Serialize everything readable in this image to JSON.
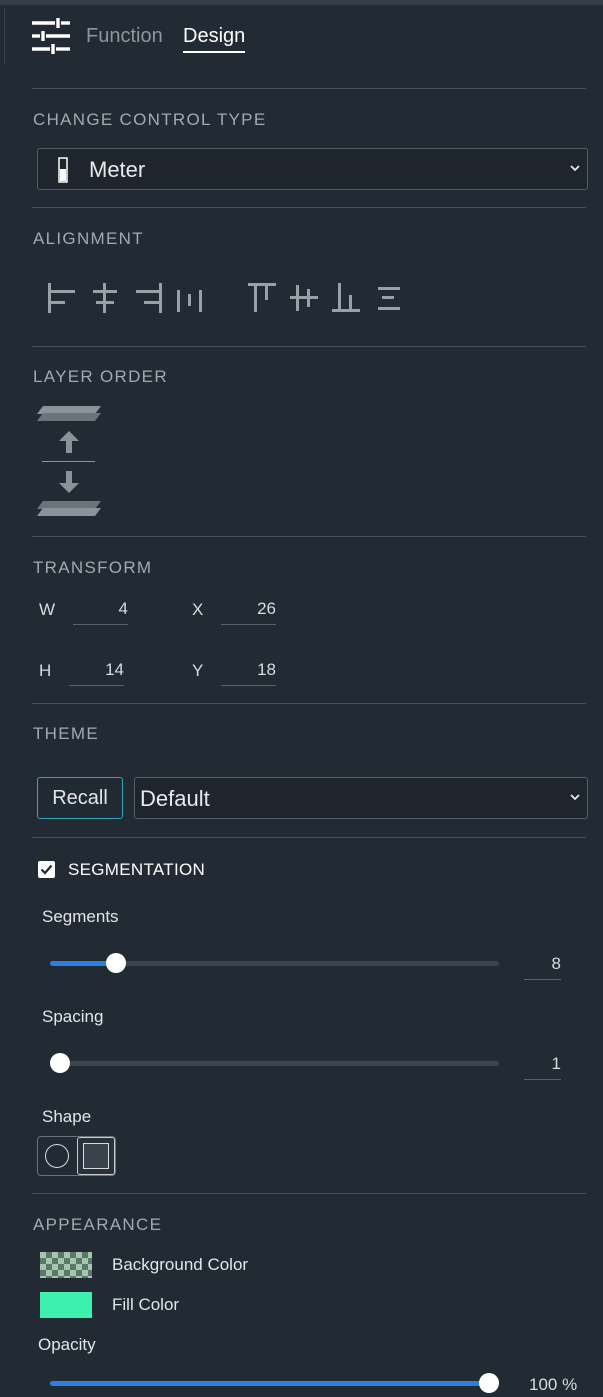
{
  "tabs": {
    "function_label": "Function",
    "design_label": "Design",
    "active": "Design"
  },
  "change_control_type": {
    "title": "CHANGE CONTROL TYPE",
    "selected": "Meter",
    "icon": "meter-icon"
  },
  "alignment": {
    "title": "ALIGNMENT",
    "buttons": [
      "align-left",
      "align-center-horizontal",
      "align-right",
      "distribute-horizontal",
      "align-top",
      "align-center-vertical",
      "align-bottom",
      "distribute-vertical"
    ]
  },
  "layer_order": {
    "title": "LAYER ORDER",
    "buttons": [
      "bring-to-front",
      "bring-forward",
      "send-backward",
      "send-to-back"
    ]
  },
  "transform": {
    "title": "TRANSFORM",
    "w_label": "W",
    "w_value": "4",
    "x_label": "X",
    "x_value": "26",
    "h_label": "H",
    "h_value": "14",
    "y_label": "Y",
    "y_value": "18"
  },
  "theme": {
    "title": "THEME",
    "recall_label": "Recall",
    "selected": "Default"
  },
  "segmentation": {
    "title": "SEGMENTATION",
    "checked": true,
    "segments_label": "Segments",
    "segments_value": "8",
    "segments_fraction": 0.13,
    "spacing_label": "Spacing",
    "spacing_value": "1",
    "spacing_fraction": 0.0,
    "shape_label": "Shape",
    "shape_options": [
      "circle",
      "square"
    ],
    "shape_selected": "square"
  },
  "appearance": {
    "title": "APPEARANCE",
    "background_color_label": "Background Color",
    "background_color": "transparent",
    "fill_color_label": "Fill Color",
    "fill_color": "#3ef0b0",
    "opacity_label": "Opacity",
    "opacity_value": "100 %",
    "opacity_fraction": 1.0
  },
  "colors": {
    "panel_bg": "#222a33",
    "accent": "#2d7ee0",
    "recall_border": "#3aa3b8"
  }
}
